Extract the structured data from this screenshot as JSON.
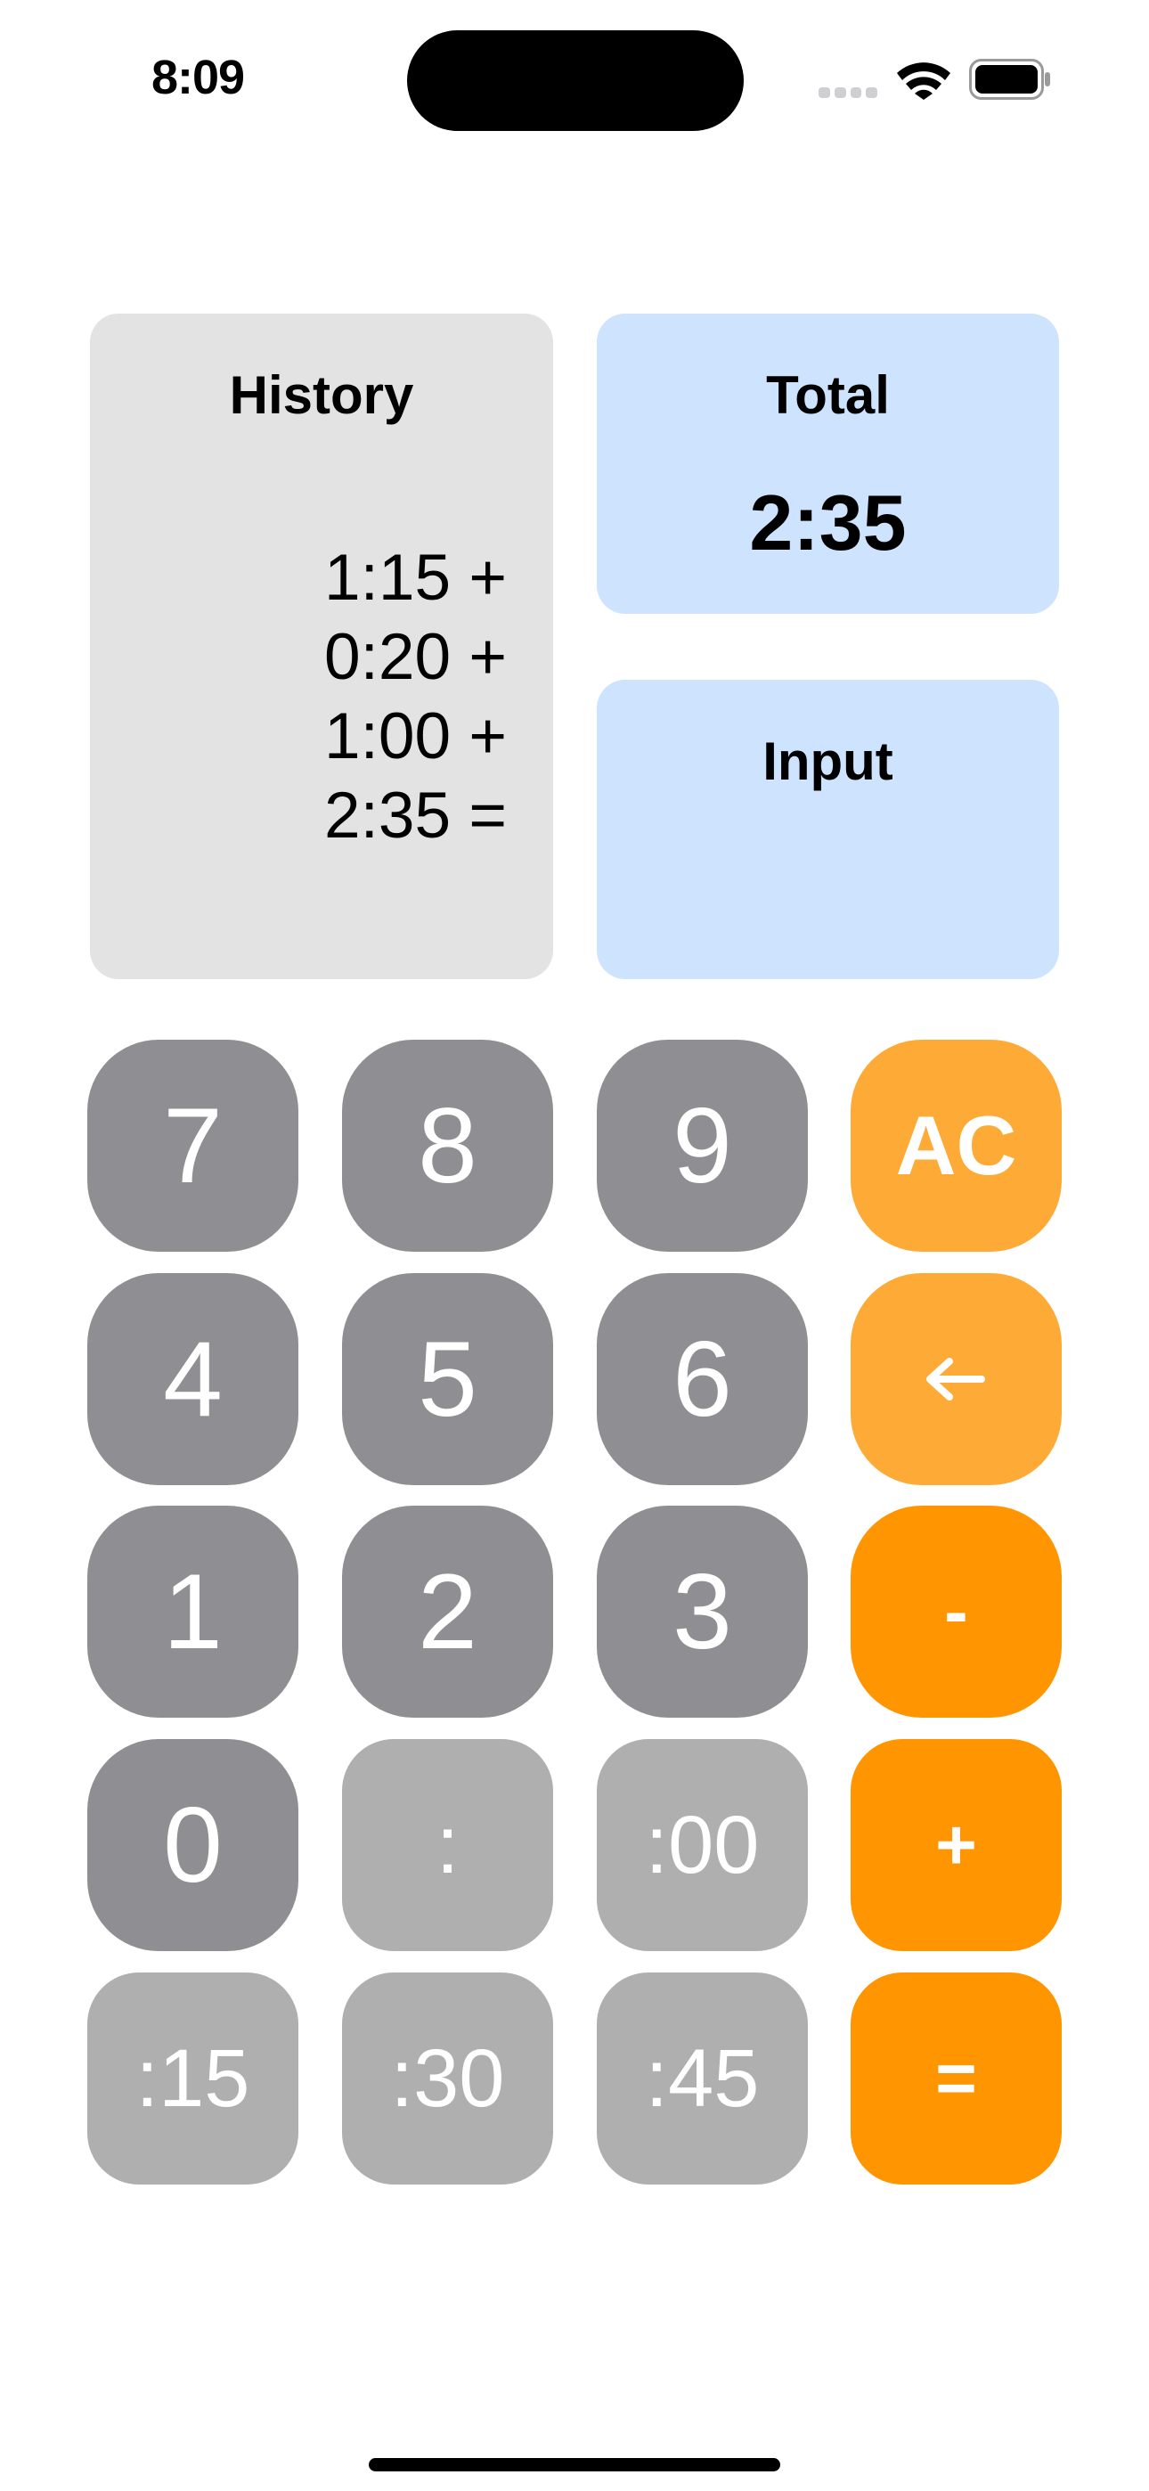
{
  "status_bar": {
    "time": "8:09",
    "icons": [
      "cellular-signal-icon",
      "wifi-icon",
      "battery-icon"
    ]
  },
  "history": {
    "title": "History",
    "lines": [
      "1:15 +",
      "0:20 +",
      "1:00 +",
      "2:35 ="
    ]
  },
  "total": {
    "title": "Total",
    "value": "2:35"
  },
  "input": {
    "title": "Input",
    "value": ""
  },
  "keypad": {
    "rows": [
      [
        {
          "label": "7",
          "name": "key-7"
        },
        {
          "label": "8",
          "name": "key-8"
        },
        {
          "label": "9",
          "name": "key-9"
        },
        {
          "label": "AC",
          "name": "all-clear-button"
        }
      ],
      [
        {
          "label": "4",
          "name": "key-4"
        },
        {
          "label": "5",
          "name": "key-5"
        },
        {
          "label": "6",
          "name": "key-6"
        },
        {
          "label": "←",
          "name": "backspace-button",
          "icon": "left-arrow-icon"
        }
      ],
      [
        {
          "label": "1",
          "name": "key-1"
        },
        {
          "label": "2",
          "name": "key-2"
        },
        {
          "label": "3",
          "name": "key-3"
        },
        {
          "label": "-",
          "name": "subtract-button"
        }
      ],
      [
        {
          "label": "0",
          "name": "key-0"
        },
        {
          "label": ":",
          "name": "colon-button"
        },
        {
          "label": ":00",
          "name": "minutes-00-button"
        },
        {
          "label": "+",
          "name": "add-button"
        }
      ],
      [
        {
          "label": ":15",
          "name": "minutes-15-button"
        },
        {
          "label": ":30",
          "name": "minutes-30-button"
        },
        {
          "label": ":45",
          "name": "minutes-45-button"
        },
        {
          "label": "=",
          "name": "equals-button"
        }
      ]
    ]
  },
  "colors": {
    "digit_key": "#8e8e93",
    "minute_key": "#afafb0",
    "control_key": "#fdaa36",
    "operator_key": "#ff9500",
    "history_panel": "#e3e3e3",
    "result_panel": "#cee3fd"
  }
}
